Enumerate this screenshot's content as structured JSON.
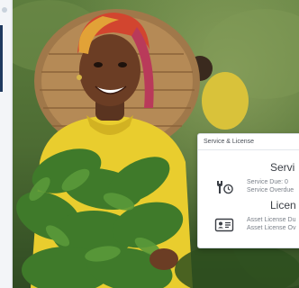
{
  "card": {
    "header": "Service & License",
    "service": {
      "title": "Servi",
      "line1": "Service Due: 0",
      "line2": "Service Overdue"
    },
    "license": {
      "title": "Licen",
      "line1": "Asset License Du",
      "line2": "Asset License Ov"
    }
  },
  "icons": {
    "service": "wrench-clock-icon",
    "license": "id-card-icon"
  },
  "colors": {
    "sidebar_accent": "#1f3a5f",
    "card_text": "#3b3f46",
    "muted_text": "#7b818a"
  }
}
